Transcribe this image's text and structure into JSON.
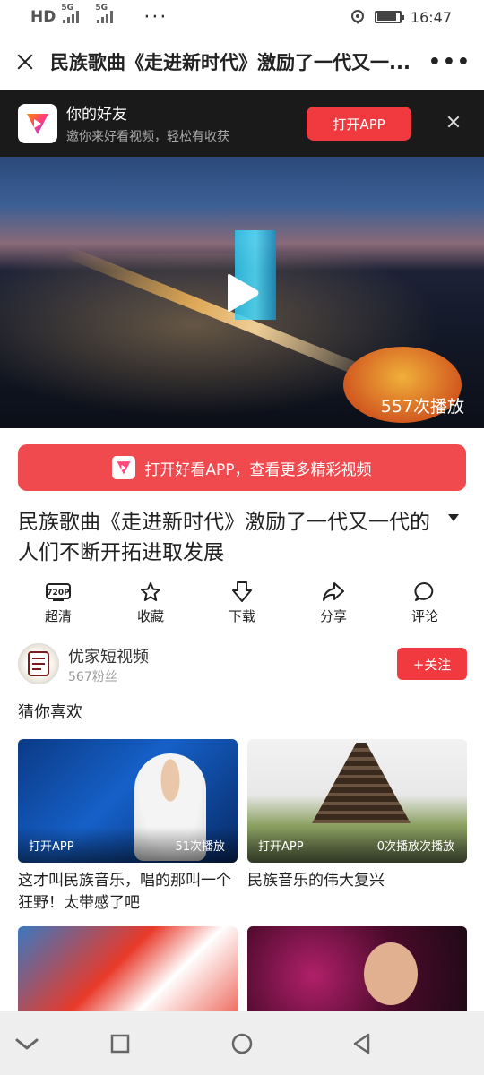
{
  "status_bar": {
    "network": "HD",
    "sim1": "5G",
    "sim2": "5G",
    "more": "···",
    "time": "16:47"
  },
  "title_bar": {
    "title": "民族歌曲《走进新时代》激励了一代又一...",
    "more": "•••"
  },
  "app_banner": {
    "title": "你的好友",
    "subtitle": "邀你来好看视频，轻松有收获",
    "open_button": "打开APP"
  },
  "video": {
    "play_count": "557次播放"
  },
  "open_cta": {
    "label": "打开好看APP，查看更多精彩视频"
  },
  "video_title": "民族歌曲《走进新时代》激励了一代又一代的人们不断开拓进取发展",
  "actions": [
    {
      "icon": "hd-720p-icon",
      "badge": "720P",
      "label": "超清"
    },
    {
      "icon": "star-icon",
      "label": "收藏"
    },
    {
      "icon": "download-icon",
      "label": "下载"
    },
    {
      "icon": "share-icon",
      "label": "分享"
    },
    {
      "icon": "comment-icon",
      "label": "评论"
    }
  ],
  "author": {
    "name": "优家短视频",
    "fans": "567粉丝",
    "follow_button": "+关注"
  },
  "recommend": {
    "section_title": "猜你喜欢",
    "cards": [
      {
        "title": "这才叫民族音乐，唱的那叫一个狂野！太带感了吧",
        "open_label": "打开APP",
        "play_count": "51次播放"
      },
      {
        "title": "民族音乐的伟大复兴",
        "open_label": "打开APP",
        "play_count": "0次播放次播放"
      },
      {
        "title": "",
        "open_label": "",
        "play_count": ""
      },
      {
        "title": "",
        "open_label": "",
        "play_count": ""
      }
    ]
  },
  "colors": {
    "accent": "#f03a3f",
    "banner_bg": "#1a1a1a"
  }
}
